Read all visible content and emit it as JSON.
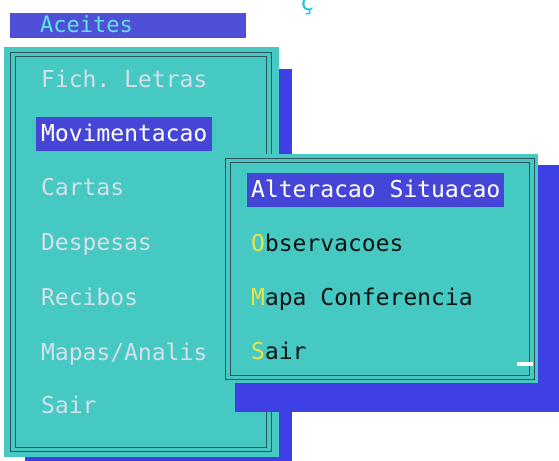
{
  "top_fragment": "ç",
  "header": {
    "title": "Aceites"
  },
  "main_menu": {
    "items": [
      {
        "label": "Fich. Letras",
        "selected": false
      },
      {
        "label": "Movimentacao",
        "selected": true
      },
      {
        "label": "Cartas",
        "selected": false
      },
      {
        "label": "Despesas",
        "selected": false
      },
      {
        "label": "Recibos",
        "selected": false
      },
      {
        "label": "Mapas/Analis",
        "selected": false
      },
      {
        "label": "Sair",
        "selected": false
      }
    ]
  },
  "submenu": {
    "items": [
      {
        "hotkey": "",
        "rest": "Alteracao Situacao",
        "selected": true
      },
      {
        "hotkey": "O",
        "rest": "bservacoes",
        "selected": false
      },
      {
        "hotkey": "M",
        "rest": "apa Conferencia",
        "selected": false
      },
      {
        "hotkey": "S",
        "rest": "air",
        "selected": false
      }
    ]
  },
  "colors": {
    "panel": "#45c9c2",
    "selection": "#4545d8",
    "shadow": "#3f3fe6",
    "hotkey": "#e8e24a",
    "disabled_text": "#d5dfe8"
  }
}
